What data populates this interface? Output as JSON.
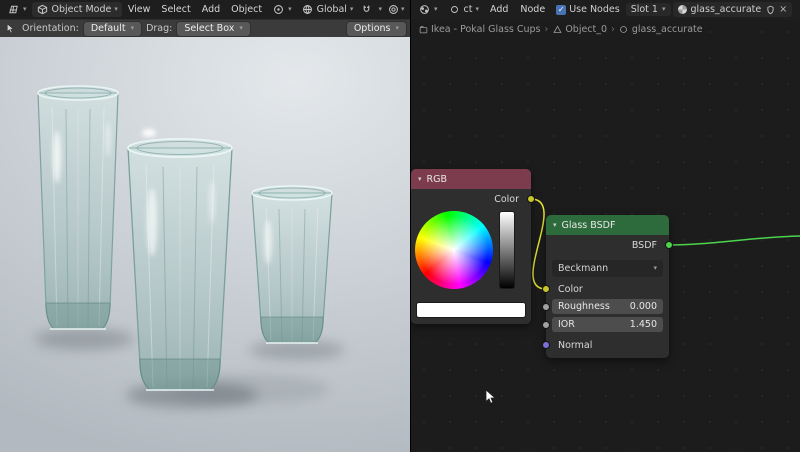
{
  "icons": {
    "chevron_down": "▾",
    "breadcrumb_sep": "›",
    "check": "✓",
    "close": "×"
  },
  "viewport": {
    "header": {
      "mode": "Object Mode",
      "menus": [
        "View",
        "Select",
        "Add",
        "Object"
      ],
      "orientation": "Global"
    },
    "toolbar": {
      "orientation_label": "Orientation:",
      "orientation_value": "Default",
      "drag_label": "Drag:",
      "drag_value": "Select Box",
      "options_label": "Options"
    }
  },
  "shader": {
    "header": {
      "shader_type": "ct",
      "add_menu": "Add",
      "node_menu": "Node",
      "use_nodes": "Use Nodes",
      "slot": "Slot 1",
      "material": "glass_accurate"
    },
    "breadcrumb": {
      "items": [
        "Ikea - Pokal Glass Cups",
        "Object_0",
        "glass_accurate"
      ]
    },
    "rgb_node": {
      "title": "RGB",
      "output": "Color"
    },
    "glass_node": {
      "title": "Glass BSDF",
      "output": "BSDF",
      "distribution": "Beckmann",
      "color_label": "Color",
      "roughness_label": "Roughness",
      "roughness_value": "0.000",
      "ior_label": "IOR",
      "ior_value": "1.450",
      "normal_label": "Normal"
    }
  },
  "colors": {
    "socket_color": "#c7c729",
    "socket_shader": "#4cd44c",
    "socket_vector": "#7a70d8",
    "socket_value": "#a1a1a1",
    "rgb_header": "#7d3c4e",
    "glass_header": "#2e6b3c",
    "wire_color": "#e3e335",
    "wire_shader": "#4cd44c",
    "use_nodes_check": "#4772b3"
  }
}
